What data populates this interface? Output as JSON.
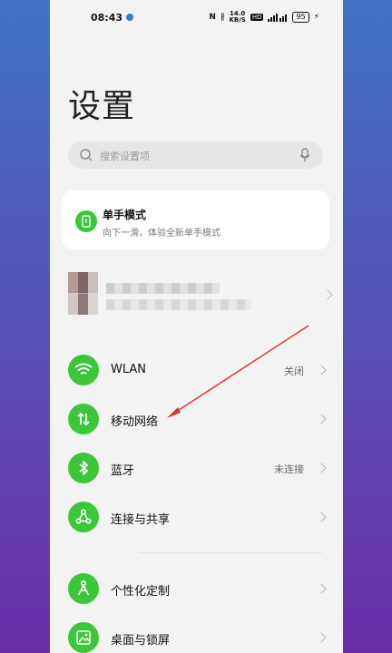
{
  "status_bar": {
    "time": "08:43",
    "nfc": "N",
    "bluetooth": "∦",
    "speed_value": "14.0",
    "speed_unit": "KB/S",
    "hd": "HD",
    "battery": "95"
  },
  "page": {
    "title": "设置"
  },
  "search": {
    "placeholder": "搜索设置项"
  },
  "one_hand_card": {
    "title": "单手模式",
    "subtitle": "向下一滑，体验全新单手模式"
  },
  "menu": {
    "items": [
      {
        "label": "WLAN",
        "value": "关闭",
        "icon": "wifi-icon"
      },
      {
        "label": "移动网络",
        "value": "",
        "icon": "mobile-network-icon"
      },
      {
        "label": "蓝牙",
        "value": "未连接",
        "icon": "bluetooth-icon"
      },
      {
        "label": "连接与共享",
        "value": "",
        "icon": "share-icon"
      },
      {
        "label": "个性化定制",
        "value": "",
        "icon": "personalize-icon"
      },
      {
        "label": "桌面与锁屏",
        "value": "",
        "icon": "desktop-icon"
      }
    ]
  },
  "colors": {
    "accent_green": "#3cc63a",
    "annotation_arrow": "#d9342b",
    "background_gradient_top": "#3f73c4",
    "background_gradient_bottom": "#6a2fa8"
  }
}
